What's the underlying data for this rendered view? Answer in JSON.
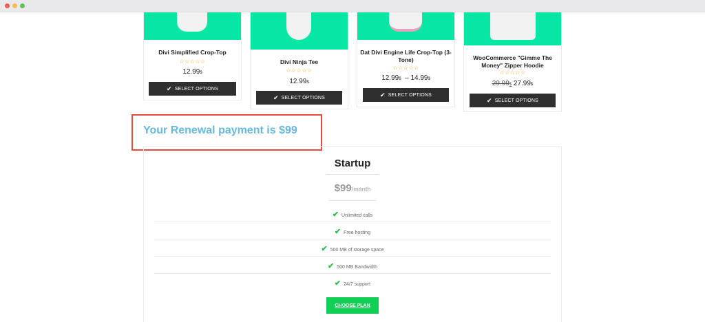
{
  "window": {
    "controls": [
      "close",
      "minimize",
      "maximize"
    ]
  },
  "products": [
    {
      "name": "Divi Simplified Crop-Top",
      "rating": "☆☆☆☆☆",
      "price": "12.99",
      "currency": "$",
      "button": "SELECT OPTIONS"
    },
    {
      "name": "Divi Ninja Tee",
      "rating": "☆☆☆☆☆",
      "price": "12.99",
      "currency": "$",
      "button": "SELECT OPTIONS"
    },
    {
      "name": "Dat Divi Engine Life Crop-Top (3-Tone)",
      "rating": "☆☆☆☆☆",
      "price_low": "12.99",
      "price_high": "14.99",
      "currency": "$",
      "range_sep": "–",
      "button": "SELECT OPTIONS"
    },
    {
      "name": "WooCommerce \"Gimme The Money\" Zipper Hoodie",
      "rating": "☆☆☆☆☆",
      "old_price": "29.99",
      "price": "27.99",
      "currency": "$",
      "button": "SELECT OPTIONS"
    }
  ],
  "icons": {
    "check": "✔"
  },
  "renewal": {
    "text": "Your Renewal payment is $99",
    "highlight_color": "#e8493f",
    "text_color": "#66b8dc"
  },
  "plan": {
    "title": "Startup",
    "price": "$99",
    "period": "/month",
    "features": [
      "Unlimited calls",
      "Free hosting",
      "500 MB of storage space",
      "500 MB Bandwidth",
      "24/7 support"
    ],
    "button": "CHOOSE PLAN",
    "accent": "#0fcf54"
  },
  "colors": {
    "product_bg": "#08e6a3",
    "button_dark": "#2f2f2f"
  }
}
